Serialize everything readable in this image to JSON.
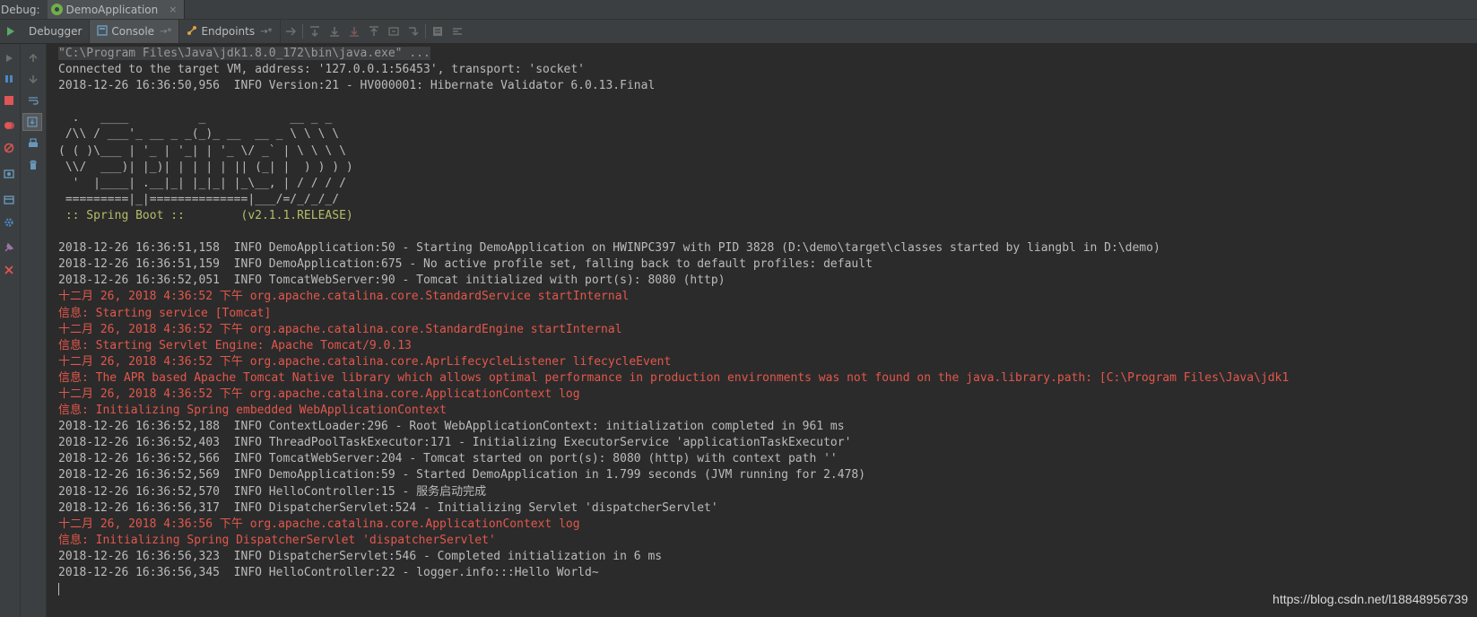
{
  "topbar": {
    "label": "Debug:",
    "tab_label": "DemoApplication",
    "tab_close": "×"
  },
  "toolstrip": {
    "tabs": [
      {
        "label": "Debugger"
      },
      {
        "label": "Console",
        "pin": "→*"
      },
      {
        "label": "Endpoints",
        "pin": "→*"
      }
    ]
  },
  "colors": {
    "background": "#2b2b2b",
    "panel": "#3c3f41",
    "text": "#bbbbbb",
    "error_red": "#e3574b",
    "spring_green": "#b5bd68"
  },
  "console": {
    "lines": [
      {
        "text": "\"C:\\Program Files\\Java\\jdk1.8.0_172\\bin\\java.exe\" ...",
        "style": "cmd"
      },
      {
        "text": "Connected to the target VM, address: '127.0.0.1:56453', transport: 'socket'",
        "style": "normal"
      },
      {
        "text": "2018-12-26 16:36:50,956  INFO Version:21 - HV000001: Hibernate Validator 6.0.13.Final",
        "style": "normal"
      },
      {
        "text": "",
        "style": "normal"
      },
      {
        "text": "  .   ____          _            __ _ _",
        "style": "normal"
      },
      {
        "text": " /\\\\ / ___'_ __ _ _(_)_ __  __ _ \\ \\ \\ \\",
        "style": "normal"
      },
      {
        "text": "( ( )\\___ | '_ | '_| | '_ \\/ _` | \\ \\ \\ \\",
        "style": "normal"
      },
      {
        "text": " \\\\/  ___)| |_)| | | | | || (_| |  ) ) ) )",
        "style": "normal"
      },
      {
        "text": "  '  |____| .__|_| |_|_| |_\\__, | / / / /",
        "style": "normal"
      },
      {
        "text": " =========|_|==============|___/=/_/_/_/",
        "style": "normal"
      },
      {
        "text": " :: Spring Boot ::        (v2.1.1.RELEASE)",
        "style": "spring"
      },
      {
        "text": "",
        "style": "normal"
      },
      {
        "text": "2018-12-26 16:36:51,158  INFO DemoApplication:50 - Starting DemoApplication on HWINPC397 with PID 3828 (D:\\demo\\target\\classes started by liangbl in D:\\demo)",
        "style": "normal"
      },
      {
        "text": "2018-12-26 16:36:51,159  INFO DemoApplication:675 - No active profile set, falling back to default profiles: default",
        "style": "normal"
      },
      {
        "text": "2018-12-26 16:36:52,051  INFO TomcatWebServer:90 - Tomcat initialized with port(s): 8080 (http)",
        "style": "normal"
      },
      {
        "text": "十二月 26, 2018 4:36:52 下午 org.apache.catalina.core.StandardService startInternal",
        "style": "red"
      },
      {
        "text": "信息: Starting service [Tomcat]",
        "style": "red"
      },
      {
        "text": "十二月 26, 2018 4:36:52 下午 org.apache.catalina.core.StandardEngine startInternal",
        "style": "red"
      },
      {
        "text": "信息: Starting Servlet Engine: Apache Tomcat/9.0.13",
        "style": "red"
      },
      {
        "text": "十二月 26, 2018 4:36:52 下午 org.apache.catalina.core.AprLifecycleListener lifecycleEvent",
        "style": "red"
      },
      {
        "text": "信息: The APR based Apache Tomcat Native library which allows optimal performance in production environments was not found on the java.library.path: [C:\\Program Files\\Java\\jdk1",
        "style": "red"
      },
      {
        "text": "十二月 26, 2018 4:36:52 下午 org.apache.catalina.core.ApplicationContext log",
        "style": "red"
      },
      {
        "text": "信息: Initializing Spring embedded WebApplicationContext",
        "style": "red"
      },
      {
        "text": "2018-12-26 16:36:52,188  INFO ContextLoader:296 - Root WebApplicationContext: initialization completed in 961 ms",
        "style": "normal"
      },
      {
        "text": "2018-12-26 16:36:52,403  INFO ThreadPoolTaskExecutor:171 - Initializing ExecutorService 'applicationTaskExecutor'",
        "style": "normal"
      },
      {
        "text": "2018-12-26 16:36:52,566  INFO TomcatWebServer:204 - Tomcat started on port(s): 8080 (http) with context path ''",
        "style": "normal"
      },
      {
        "text": "2018-12-26 16:36:52,569  INFO DemoApplication:59 - Started DemoApplication in 1.799 seconds (JVM running for 2.478)",
        "style": "normal"
      },
      {
        "text": "2018-12-26 16:36:52,570  INFO HelloController:15 - 服务启动完成",
        "style": "normal"
      },
      {
        "text": "2018-12-26 16:36:56,317  INFO DispatcherServlet:524 - Initializing Servlet 'dispatcherServlet'",
        "style": "normal"
      },
      {
        "text": "十二月 26, 2018 4:36:56 下午 org.apache.catalina.core.ApplicationContext log",
        "style": "red"
      },
      {
        "text": "信息: Initializing Spring DispatcherServlet 'dispatcherServlet'",
        "style": "red"
      },
      {
        "text": "2018-12-26 16:36:56,323  INFO DispatcherServlet:546 - Completed initialization in 6 ms",
        "style": "normal"
      },
      {
        "text": "2018-12-26 16:36:56,345  INFO HelloController:22 - logger.info:::Hello World~",
        "style": "normal"
      }
    ]
  },
  "watermark": "https://blog.csdn.net/l18848956739"
}
